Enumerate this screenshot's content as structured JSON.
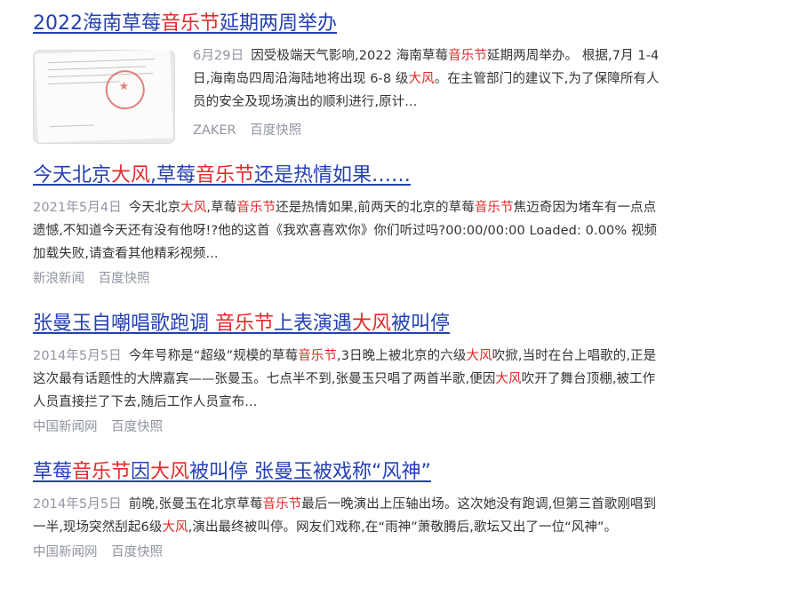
{
  "results": [
    {
      "title_parts": [
        {
          "t": "2022海南草莓",
          "hl": false
        },
        {
          "t": "音乐节",
          "hl": true
        },
        {
          "t": "延期两周举办",
          "hl": false
        }
      ],
      "date": "6月29日",
      "snippet_parts": [
        {
          "t": "因受极端天气影响,2022 海南草莓",
          "hl": false
        },
        {
          "t": "音乐节",
          "hl": true
        },
        {
          "t": "延期两周举办。 根据,7月 1-4 日,海南岛四周沿海陆地将出现 6-8 级",
          "hl": false
        },
        {
          "t": "大风",
          "hl": true
        },
        {
          "t": "。在主管部门的建议下,为了保障所有人员的安全及现场演出的顺利进行,原计...",
          "hl": false
        }
      ],
      "source": "ZAKER",
      "cache": "百度快照",
      "has_thumb": true
    },
    {
      "title_parts": [
        {
          "t": "今天北京",
          "hl": false
        },
        {
          "t": "大风",
          "hl": true
        },
        {
          "t": ",草莓",
          "hl": false
        },
        {
          "t": "音乐节",
          "hl": true
        },
        {
          "t": "还是热情如果……",
          "hl": false
        }
      ],
      "date": "2021年5月4日",
      "snippet_parts": [
        {
          "t": "今天北京",
          "hl": false
        },
        {
          "t": "大风",
          "hl": true
        },
        {
          "t": ",草莓",
          "hl": false
        },
        {
          "t": "音乐节",
          "hl": true
        },
        {
          "t": "还是热情如果,前两天的北京的草莓",
          "hl": false
        },
        {
          "t": "音乐节",
          "hl": true
        },
        {
          "t": "焦迈奇因为堵车有一点点遗憾,不知道今天还有没有他呀!?他的这首《我欢喜喜欢你》你们听过吗?00:00/00:00 Loaded: 0.00% 视频加载失败,请查看其他精彩视频...",
          "hl": false
        }
      ],
      "source": "新浪新闻",
      "cache": "百度快照",
      "has_thumb": false
    },
    {
      "title_parts": [
        {
          "t": "张曼玉自嘲唱歌跑调 ",
          "hl": false
        },
        {
          "t": "音乐节",
          "hl": true
        },
        {
          "t": "上表演遇",
          "hl": false
        },
        {
          "t": "大风",
          "hl": true
        },
        {
          "t": "被叫停",
          "hl": false
        }
      ],
      "date": "2014年5月5日",
      "snippet_parts": [
        {
          "t": "今年号称是“超级”规模的草莓",
          "hl": false
        },
        {
          "t": "音乐节",
          "hl": true
        },
        {
          "t": ",3日晚上被北京的六级",
          "hl": false
        },
        {
          "t": "大风",
          "hl": true
        },
        {
          "t": "吹掀,当时在台上唱歌的,正是这次最有话题性的大牌嘉宾——张曼玉。七点半不到,张曼玉只唱了两首半歌,便因",
          "hl": false
        },
        {
          "t": "大风",
          "hl": true
        },
        {
          "t": "吹开了舞台顶棚,被工作人员直接拦了下去,随后工作人员宣布...",
          "hl": false
        }
      ],
      "source": "中国新闻网",
      "cache": "百度快照",
      "has_thumb": false
    },
    {
      "title_parts": [
        {
          "t": "草莓",
          "hl": false
        },
        {
          "t": "音乐节",
          "hl": true
        },
        {
          "t": "因",
          "hl": false
        },
        {
          "t": "大风",
          "hl": true
        },
        {
          "t": "被叫停 张曼玉被戏称“风神”",
          "hl": false
        }
      ],
      "date": "2014年5月5日",
      "snippet_parts": [
        {
          "t": "前晚,张曼玉在北京草莓",
          "hl": false
        },
        {
          "t": "音乐节",
          "hl": true
        },
        {
          "t": "最后一晚演出上压轴出场。这次她没有跑调,但第三首歌刚唱到一半,现场突然刮起6级",
          "hl": false
        },
        {
          "t": "大风",
          "hl": true
        },
        {
          "t": ",演出最终被叫停。网友们戏称,在“雨神”萧敬腾后,歌坛又出了一位“风神”。",
          "hl": false
        }
      ],
      "source": "中国新闻网",
      "cache": "百度快照",
      "has_thumb": false
    }
  ]
}
